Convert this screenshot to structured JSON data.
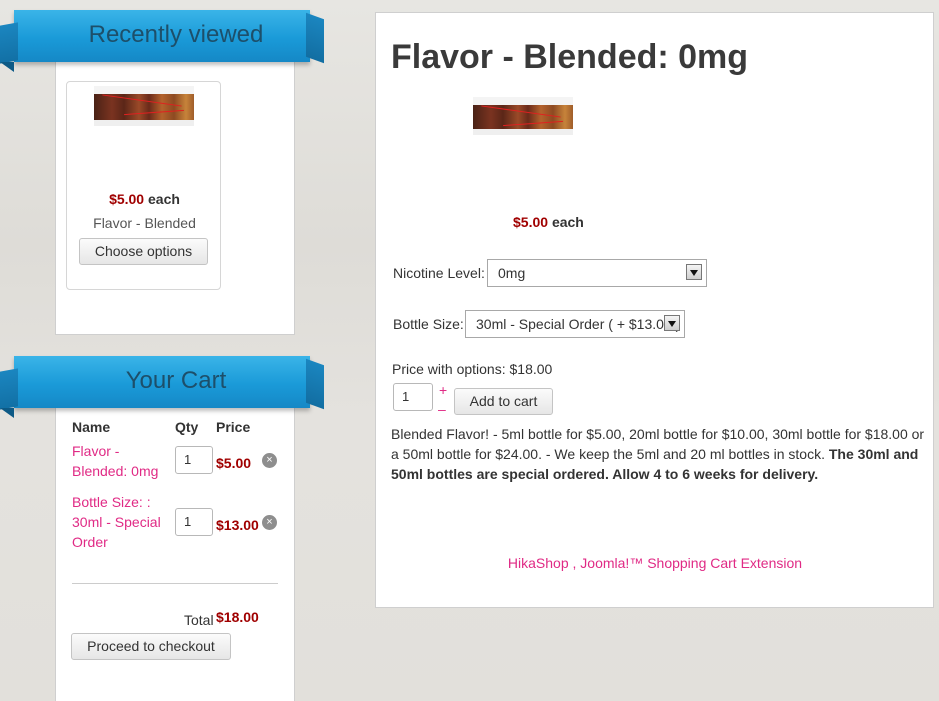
{
  "recently_viewed": {
    "title": "Recently viewed",
    "product": {
      "image_alt": "flavor-blended-image",
      "price": "$5.00",
      "price_unit": "each",
      "name": "Flavor - Blended",
      "button": "Choose options"
    }
  },
  "cart": {
    "title": "Your Cart",
    "headers": {
      "name": "Name",
      "qty": "Qty",
      "price": "Price"
    },
    "items": [
      {
        "name_line1": "Flavor -",
        "name_line2": "Blended: 0mg",
        "name_line3": "",
        "qty": "1",
        "price": "$5.00"
      },
      {
        "name_line1": "Bottle Size: :",
        "name_line2": "30ml - Special",
        "name_line3": "Order",
        "qty": "1",
        "price": "$13.00"
      }
    ],
    "total_label": "Total",
    "total_value": "$18.00",
    "checkout_button": "Proceed to checkout",
    "remove_icon": "×"
  },
  "product": {
    "title": "Flavor - Blended: 0mg",
    "price": "$5.00",
    "price_unit": "each",
    "nicotine_label": "Nicotine Level:",
    "nicotine_value": "0mg",
    "bottle_label": "Bottle Size:",
    "bottle_value": "30ml - Special Order ( + $13.00 )",
    "price_with_options": "Price with options: $18.00",
    "qty": "1",
    "qty_plus": "+",
    "qty_minus": "–",
    "add_to_cart": "Add to cart",
    "description_plain": "Blended Flavor! - 5ml bottle for $5.00, 20ml bottle for $10.00, 30ml bottle for $18.00 or a 50ml bottle for $24.00. - We keep the 5ml and 20 ml bottles in stock.",
    "description_bold": "The 30ml and 50ml bottles are special ordered. Allow 4 to 6 weeks for delivery.",
    "footer_link": "HikaShop , Joomla!™ Shopping Cart Extension"
  },
  "colors": {
    "price": "#a00000",
    "link": "#e02a85",
    "ribbon": "#1a9ad8"
  }
}
